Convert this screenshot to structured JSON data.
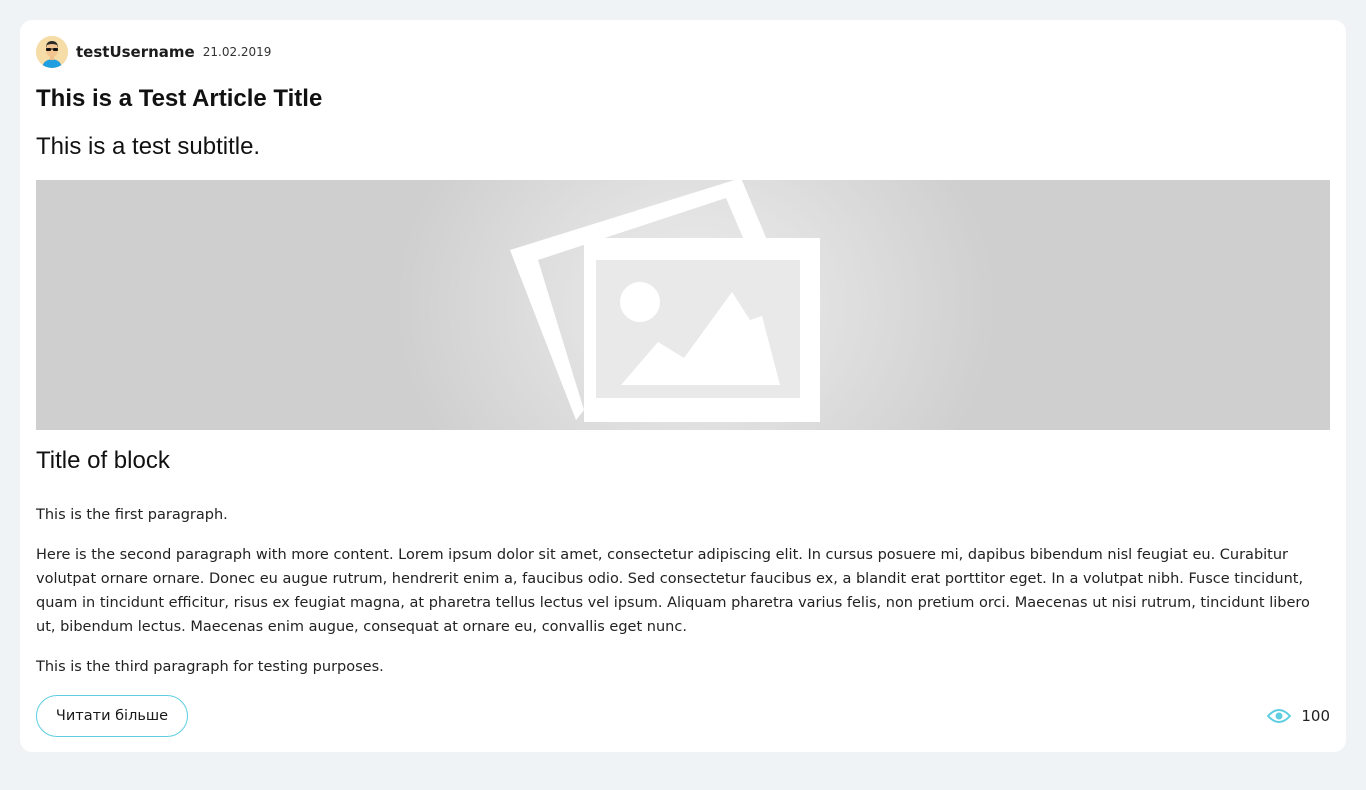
{
  "author": {
    "username": "testUsername",
    "date": "21.02.2019",
    "avatar_icon": "avatar-person-sunglasses"
  },
  "article": {
    "title": "This is a Test Article Title",
    "subtitle": "This is a test subtitle.",
    "image_icon": "image-placeholder-icon",
    "block_title": "Title of block",
    "paragraphs": [
      "This is the first paragraph.",
      "Here is the second paragraph with more content. Lorem ipsum dolor sit amet, consectetur adipiscing elit. In cursus posuere mi, dapibus bibendum nisl feugiat eu. Curabitur volutpat ornare ornare. Donec eu augue rutrum, hendrerit enim a, faucibus odio. Sed consectetur faucibus ex, a blandit erat porttitor eget. In a volutpat nibh. Fusce tincidunt, quam in tincidunt efficitur, risus ex feugiat magna, at pharetra tellus lectus vel ipsum. Aliquam pharetra varius felis, non pretium orci. Maecenas ut nisi rutrum, tincidunt libero ut, bibendum lectus. Maecenas enim augue, consequat at ornare eu, convallis eget nunc.",
      "This is the third paragraph for testing purposes."
    ]
  },
  "footer": {
    "read_more_label": "Читати більше",
    "views_icon": "eye-icon",
    "views_count": "100"
  },
  "colors": {
    "accent": "#5ecee0",
    "page_background": "#eff3f6",
    "card_background": "#ffffff"
  }
}
